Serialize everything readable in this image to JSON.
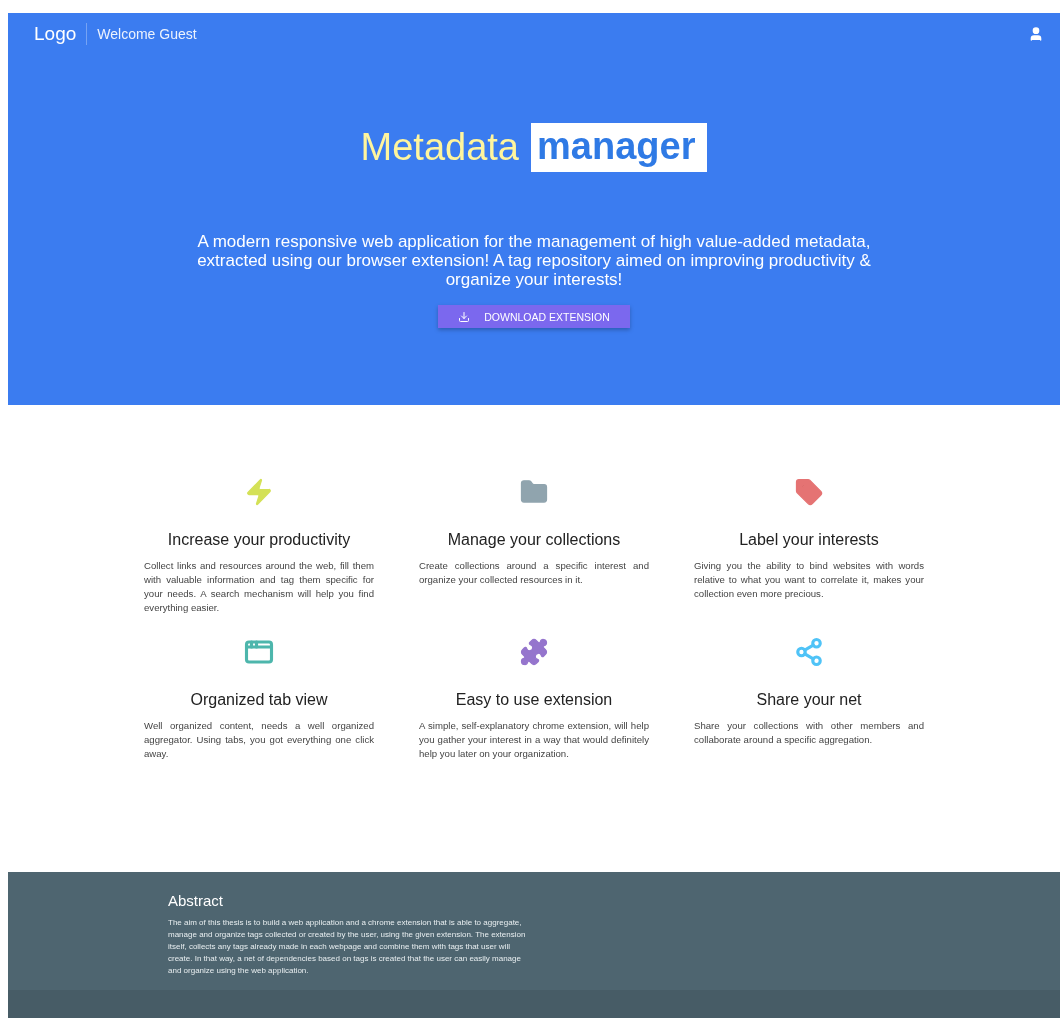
{
  "navbar": {
    "logo": "Logo",
    "welcome": "Welcome Guest"
  },
  "hero": {
    "title_light": "Metadata",
    "title_highlight": "manager",
    "description": "A modern responsive web application for the management of high value-added metadata, extracted using our browser extension! A tag repository aimed on improving productivity & organize your interests!",
    "button": "DOWNLOAD EXTENSION"
  },
  "features": [
    {
      "kind": "bolt",
      "color": "#d4e157",
      "title": "Increase your productivity",
      "text": "Collect links and resources around the web, fill them with valuable information and tag them specific for your needs. A search mechanism will help you find everything easier."
    },
    {
      "kind": "folder",
      "color": "#90a4ae",
      "title": "Manage your collections",
      "text": "Create collections around a specific interest and organize your collected resources in it."
    },
    {
      "kind": "tag",
      "color": "#e57373",
      "title": "Label your interests",
      "text": "Giving you the ability to bind websites with words relative to what you want to correlate it, makes your collection even more precious."
    },
    {
      "kind": "tab",
      "color": "#4db6ac",
      "title": "Organized tab view",
      "text": "Well organized content, needs a well organized aggregator. Using tabs, you got everything one click away."
    },
    {
      "kind": "puzzle",
      "color": "#9575cd",
      "title": "Easy to use extension",
      "text": "A simple, self-explanatory chrome extension, will help you gather your interest in a way that would definitely help you later on your organization."
    },
    {
      "kind": "share",
      "color": "#4fc3f7",
      "title": "Share your net",
      "text": "Share your collections with other members and collaborate around a specific aggregation."
    }
  ],
  "footer": {
    "heading": "Abstract",
    "text": "The aim of this thesis is to build a web application and a chrome extension that is able to aggregate, manage and organize tags collected or created by the user, using the given extension. The extension itself, collects any tags already made in each webpage and combine them with tags that user will create. In that way, a net of dependencies based on tags is created that the user can easily manage and organize using the web application."
  }
}
